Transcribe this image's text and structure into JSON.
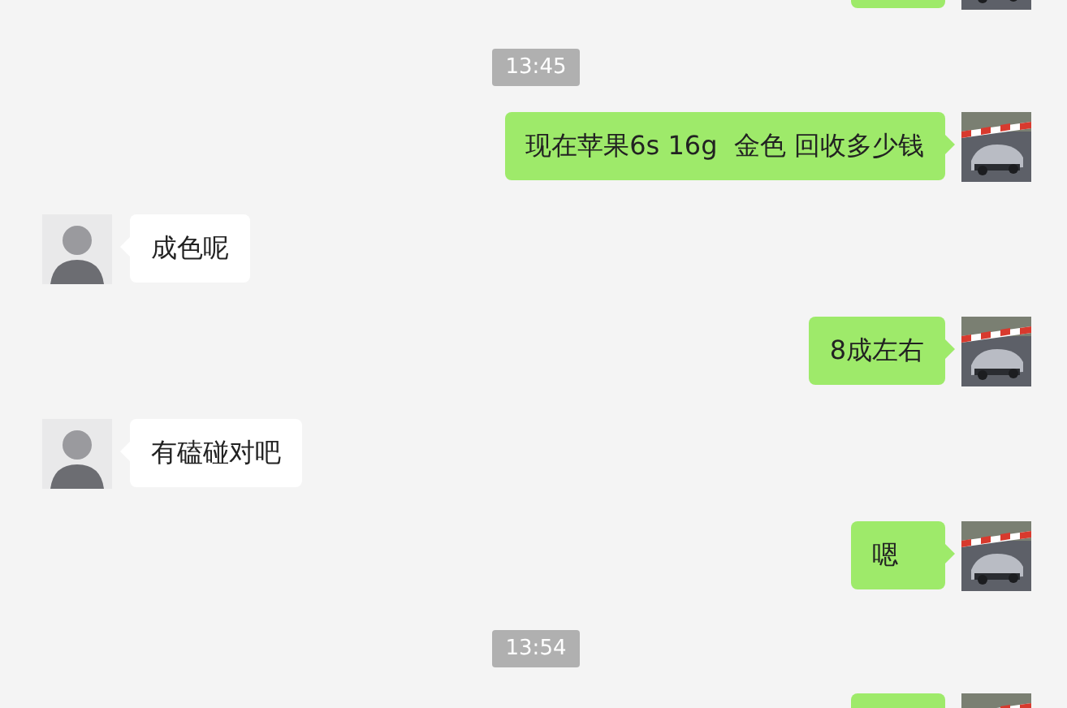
{
  "messages": [
    {
      "kind": "sent"
    },
    {
      "kind": "time",
      "text": "13:45"
    },
    {
      "kind": "sent",
      "text": "现在苹果6s 16g  金色 回收多少钱"
    },
    {
      "kind": "received",
      "text": "成色呢"
    },
    {
      "kind": "sent",
      "text": "8成左右"
    },
    {
      "kind": "received",
      "text": "有磕碰对吧"
    },
    {
      "kind": "sent",
      "text": "嗯"
    },
    {
      "kind": "time",
      "text": "13:54"
    },
    {
      "kind": "sent"
    }
  ]
}
